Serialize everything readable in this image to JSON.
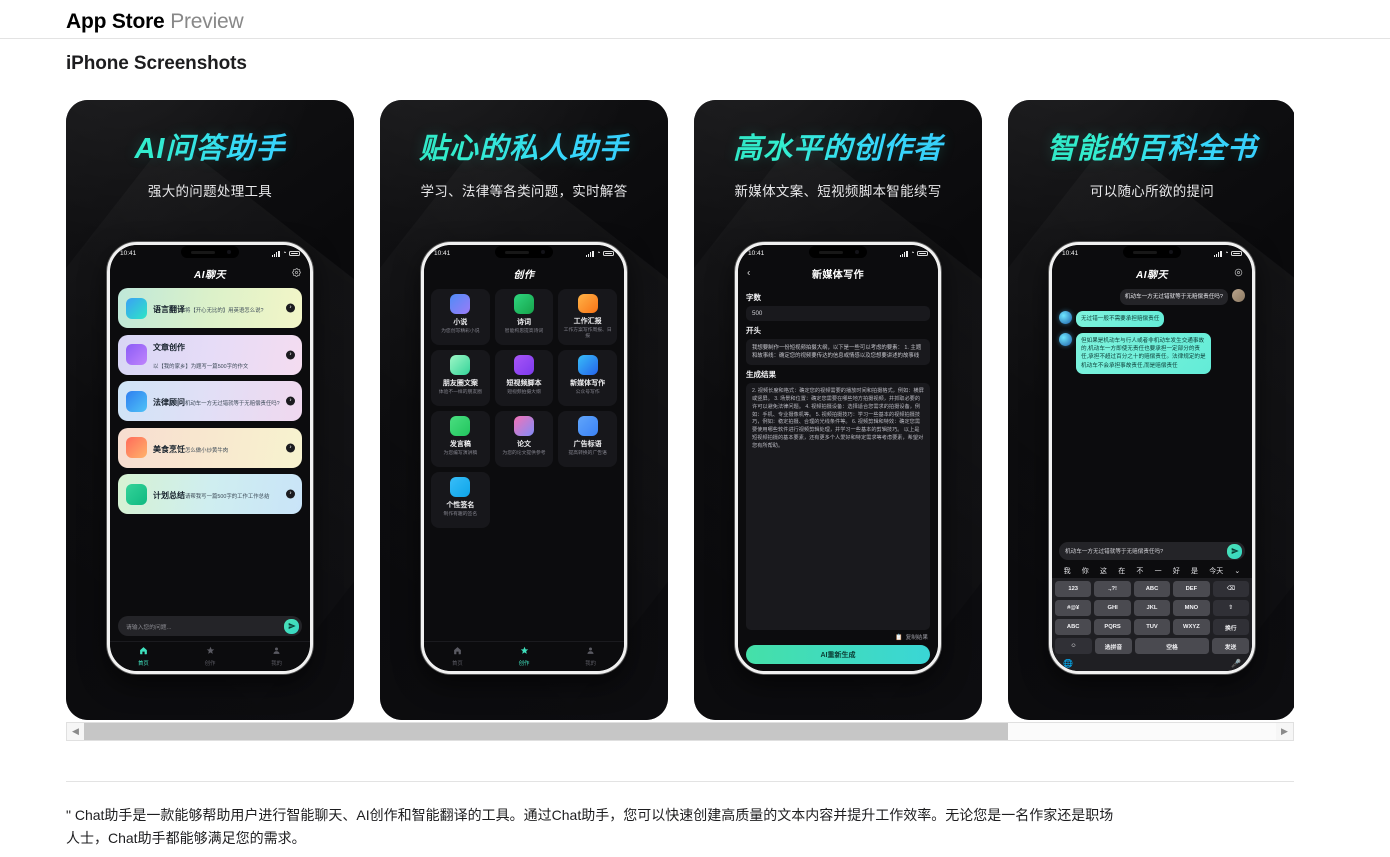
{
  "header": {
    "title_bold": "App Store",
    "title_dim": "Preview"
  },
  "section": {
    "title": "iPhone Screenshots"
  },
  "scrollbar": {
    "left_arrow": "◀",
    "right_arrow": "▶"
  },
  "description": "\" Chat助手是一款能够帮助用户进行智能聊天、AI创作和智能翻译的工具。通过Chat助手，您可以快速创建高质量的文本内容并提升工作效率。无论您是一名作家还是职场人士，Chat助手都能够满足您的需求。",
  "colors": {
    "accent_teal": "#3fe0bd",
    "accent_cyan": "#39c8ff",
    "hero_gradient_from": "#2fe3c0",
    "hero_gradient_to": "#39c8ff",
    "shot_bg": "#0b0b0d",
    "phone_screen": "#0c0c0e"
  },
  "status_bar": {
    "time": "10:41",
    "wifi": "▼",
    "icons": [
      "signal-bars",
      "wifi",
      "battery"
    ]
  },
  "shots": [
    {
      "hero_title": "AI问答助手",
      "hero_sub": "强大的问题处理工具",
      "app_bar_title": "AI聊天",
      "settings_icon": "gear-icon",
      "cards": [
        {
          "title": "语言翻译",
          "desc": "将【开心无比的】用英语怎么说?",
          "bg": "linear-gradient(100deg,#bfe8d9,#dcf1c9,#f3f6c8)",
          "icon": "linear-gradient(135deg,#3aa0f5,#2ee6c6)",
          "go": "›"
        },
        {
          "title": "文章创作",
          "desc": "以【我的家乡】为题写一篇500字的作文",
          "bg": "linear-gradient(100deg,#d8d6f5,#e6dcf7,#f4dcf0)",
          "icon": "linear-gradient(135deg,#8b5cf6,#c084fc)",
          "go": "›"
        },
        {
          "title": "法律顾问",
          "desc": "机动车一方无过错就等于无赔偿责任吗?",
          "bg": "linear-gradient(100deg,#cfe4f7,#e2dff6,#f0d8ef)",
          "icon": "linear-gradient(135deg,#2f7ff0,#4fc3f7)",
          "go": "›"
        },
        {
          "title": "美食烹饪",
          "desc": "怎么做小炒黄牛肉",
          "bg": "linear-gradient(100deg,#f7ddd0,#f8e8cf,#f7f3cf)",
          "icon": "linear-gradient(135deg,#ff6b5a,#ffb36b)",
          "go": "›"
        },
        {
          "title": "计划总结",
          "desc": "请帮我写一篇500字的工作工作总结",
          "bg": "linear-gradient(100deg,#d6f2d2,#cfeef0,#c9e4f8)",
          "icon": "linear-gradient(135deg,#34d399,#10b981)",
          "go": "›"
        }
      ],
      "composer_placeholder": "请输入您的问题...",
      "send_icon": "send-icon",
      "tabs": [
        {
          "label": "首页",
          "icon": "home-icon",
          "active": true
        },
        {
          "label": "创作",
          "icon": "create-icon",
          "active": false
        },
        {
          "label": "我的",
          "icon": "profile-icon",
          "active": false
        }
      ]
    },
    {
      "hero_title": "贴心的私人助手",
      "hero_sub": "学习、法律等各类问题，实时解答",
      "app_bar_title": "创作",
      "grid": [
        {
          "title": "小说",
          "desc": "为您创写精彩小说",
          "icon": "linear-gradient(135deg,#4f8cf7,#9b7bf7)"
        },
        {
          "title": "诗词",
          "desc": "智能构思提高诗词",
          "icon": "linear-gradient(135deg,#2fd67f,#16a34a)"
        },
        {
          "title": "工作汇报",
          "desc": "工作方案写作周报、日报",
          "icon": "linear-gradient(135deg,#ffb347,#f97316)"
        },
        {
          "title": "朋友圈文案",
          "desc": "体验不一样的朋友圈",
          "icon": "linear-gradient(135deg,#9ef7c6,#34d399)"
        },
        {
          "title": "短视频脚本",
          "desc": "短视频拍摄大纲",
          "icon": "linear-gradient(135deg,#a855f7,#7c3aed)"
        },
        {
          "title": "新媒体写作",
          "desc": "公众号写作",
          "icon": "linear-gradient(135deg,#38bdf8,#2563eb)"
        },
        {
          "title": "发言稿",
          "desc": "为您编写演讲稿",
          "icon": "linear-gradient(135deg,#4ade80,#22c55e)"
        },
        {
          "title": "论文",
          "desc": "为您的论文提供参考",
          "icon": "linear-gradient(135deg,#f472b6,#818cf8)"
        },
        {
          "title": "广告标语",
          "desc": "提高转换的广告语",
          "icon": "linear-gradient(135deg,#60a5fa,#3b82f6)"
        },
        {
          "title": "个性签名",
          "desc": "制作有趣的签名",
          "icon": "linear-gradient(135deg,#38bdf8,#0ea5e9)"
        }
      ],
      "tabs": [
        {
          "label": "首页",
          "icon": "home-icon",
          "active": false
        },
        {
          "label": "创作",
          "icon": "create-icon",
          "active": true
        },
        {
          "label": "我的",
          "icon": "profile-icon",
          "active": false
        }
      ]
    },
    {
      "hero_title": "高水平的创作者",
      "hero_sub": "新媒体文案、短视频脚本智能续写",
      "app_bar_title": "新媒体写作",
      "back_icon": "chevron-left-icon",
      "word_count_label": "字数",
      "word_count_value": "500",
      "opening_label": "开头",
      "opening_text": "我想要制作一份短视频拍摄大纲，以下是一些可以考虑的要素：\n1. 主题和故事线：确定您的视频要传达的信息或情感以及您想要讲述的故事线",
      "result_label": "生成结果",
      "result_text": "2. 视频长度和格式：确定您的视频需要的播放时间和拍摄格式，例如：横屏或竖屏。\n3. 场景和位置：确定您需要在哪些地方拍摄视频，并抓取必要的许可以避免法律问题。\n4. 视频拍摄设备：选择适合您需求的拍摄设备，例如：手机、专业摄像机等。\n5. 视频拍摄技巧：学习一些基本的视频拍摄技巧，例如：稳定拍摄、合理的光线条件等。\n6. 视频剪辑和特效：确定您需要使用哪些软件进行视频剪辑处理，并学习一些基本的剪辑技巧。\n以上是短视频拍摄的基本要素，还有更多个人爱好和特定需求等考虑要素，希望对您有所帮助。",
      "copy_label": "复制结果",
      "copy_icon": "copy-icon",
      "regenerate_label": "AI重新生成"
    },
    {
      "hero_title": "智能的百科全书",
      "hero_sub": "可以随心所欲的提问",
      "app_bar_title": "AI聊天",
      "settings_icon": "gear-icon",
      "messages": [
        {
          "from": "user",
          "text": "机动车一方无过错就等于无赔偿责任吗?"
        },
        {
          "from": "ai",
          "text": "无过错一般不需要承担赔偿责任"
        },
        {
          "from": "ai",
          "text": "但如果是机动车与行人或者非机动车发生交通事故的,机动车一方即使无责任也要承担一定部分的责任,承担不超过百分之十的赔偿责任。法律规定的是机动车不会承担事故责任,而是赔偿责任"
        }
      ],
      "composer_value": "机动车一方无过错就等于无赔偿责任吗?",
      "send_icon": "send-icon",
      "predictions": [
        "我",
        "你",
        "这",
        "在",
        "不",
        "一",
        "好",
        "是",
        "今天"
      ],
      "predict_more_icon": "chevron-down-icon",
      "keyboard": {
        "row1": [
          "123",
          ".,?!",
          "ABC",
          "DEF",
          "⌫"
        ],
        "row2": [
          "#@¥",
          "GHI",
          "JKL",
          "MNO",
          "⇧"
        ],
        "row3": [
          "ABC",
          "PQRS",
          "TUV",
          "WXYZ",
          "换行"
        ],
        "row4": [
          "☺",
          "选拼音",
          "空格",
          "发送"
        ],
        "globe_icon": "globe-icon",
        "mic_icon": "microphone-icon"
      }
    }
  ]
}
